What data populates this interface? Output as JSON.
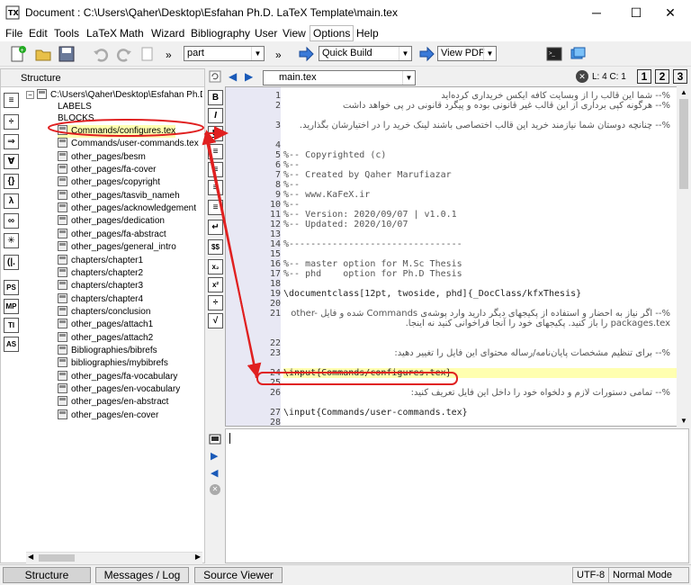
{
  "window": {
    "title": "Document : C:\\Users\\Qaher\\Desktop\\Esfahan Ph.D. LaTeX Template\\main.tex",
    "minimize": "─",
    "maximize": "☐",
    "close": "✕"
  },
  "menu": [
    "File",
    "Edit",
    "Tools",
    "LaTeX",
    "Math",
    "Wizard",
    "Bibliography",
    "User",
    "View",
    "Options",
    "Help"
  ],
  "toolbar": {
    "section_combo": "part",
    "build_combo": "Quick Build",
    "view_combo": "View PDF",
    "more": "»"
  },
  "structure": {
    "header": "Structure",
    "root": "C:\\Users\\Qaher\\Desktop\\Esfahan Ph.D.",
    "labels": "LABELS",
    "blocks": "BLOCKS",
    "files": [
      "Commands/configures.tex",
      "Commands/user-commands.tex",
      "other_pages/besm",
      "other_pages/fa-cover",
      "other_pages/copyright",
      "other_pages/tasvib_nameh",
      "other_pages/acknowledgement",
      "other_pages/dedication",
      "other_pages/fa-abstract",
      "other_pages/general_intro",
      "chapters/chapter1",
      "chapters/chapter2",
      "chapters/chapter3",
      "chapters/chapter4",
      "chapters/conclusion",
      "other_pages/attach1",
      "other_pages/attach2",
      "Bibliographies/bibrefs",
      "bibliographies/mybibrefs",
      "other_pages/fa-vocabulary",
      "other_pages/en-vocabulary",
      "other_pages/en-abstract",
      "other_pages/en-cover"
    ],
    "side_icons": [
      "≡",
      "÷",
      "⇒",
      "∀",
      "{}",
      "λ",
      "∞",
      "✳",
      "(|.",
      "PS",
      "MP",
      "TI",
      "AS"
    ]
  },
  "editor": {
    "file_combo": "main.tex",
    "cursor_pos": "L: 4 C: 1",
    "view_buttons": [
      "1",
      "2",
      "3"
    ],
    "side_icons": [
      "B",
      "I",
      "U",
      "≡",
      "≡",
      "≡",
      "≡",
      "↵",
      "$$",
      "x₂",
      "x²",
      "÷",
      "√"
    ],
    "lines": [
      {
        "n": "1",
        "t": "%-- شما این قالب را از وبسایت کافه ایکس خریداری کرده‌اید",
        "rtl": true
      },
      {
        "n": "2",
        "t": "%-- هرگونه کپی برداری از این قالب غیر قانونی بوده و پیگرد قانونی در پی خواهد داشت",
        "rtl": true
      },
      {
        "n": "3",
        "t": "%-- چنانچه دوستان شما نیازمند خرید این قالب اختصاصی باشند لینک خرید را در اختیارشان بگذارید.",
        "rtl": true
      },
      {
        "n": "4",
        "t": ""
      },
      {
        "n": "5",
        "t": "%-- Copyrighted (c)"
      },
      {
        "n": "6",
        "t": "%--"
      },
      {
        "n": "7",
        "t": "%-- Created by Qaher Marufiazar"
      },
      {
        "n": "8",
        "t": "%--"
      },
      {
        "n": "9",
        "t": "%-- www.KaFeX.ir"
      },
      {
        "n": "10",
        "t": "%--"
      },
      {
        "n": "11",
        "t": "%-- Version: 2020/09/07 | v1.0.1"
      },
      {
        "n": "12",
        "t": "%-- Updated: 2020/10/07"
      },
      {
        "n": "13",
        "t": ""
      },
      {
        "n": "14",
        "t": "%--------------------------------"
      },
      {
        "n": "15",
        "t": ""
      },
      {
        "n": "16",
        "t": "%-- master option for M.Sc Thesis"
      },
      {
        "n": "17",
        "t": "%-- phd    option for Ph.D Thesis"
      },
      {
        "n": "18",
        "t": ""
      },
      {
        "n": "19",
        "t": "\\documentclass[12pt, twoside, phd]{_DocClass/kfxThesis}"
      },
      {
        "n": "20",
        "t": ""
      },
      {
        "n": "21",
        "t": "%-- اگر نیاز به احضار و استفاده از پکیجهای دیگر دارید وارد پوشه‌ی Commands شده و فایل other-packages.tex را باز کنید. پکیجهای خود را آنجا فراخوانی کنید نه اینجا.",
        "rtl": true
      },
      {
        "n": "22",
        "t": ""
      },
      {
        "n": "23",
        "t": "%-- برای تنظیم مشخصات پایان‌نامه/رساله محتوای این فایل را تغییر دهید:",
        "rtl": true
      },
      {
        "n": "24",
        "t": "\\input{Commands/configures.tex}"
      },
      {
        "n": "25",
        "t": ""
      },
      {
        "n": "26",
        "t": "%-- تمامی دستورات لازم و دلخواه خود را داخل این فایل تعریف کنید:",
        "rtl": true
      },
      {
        "n": "27",
        "t": "\\input{Commands/user-commands.tex}"
      },
      {
        "n": "28",
        "t": ""
      }
    ]
  },
  "status": {
    "tabs": [
      "Structure",
      "Messages / Log",
      "Source Viewer"
    ],
    "encoding": "UTF-8",
    "mode": "Normal Mode"
  },
  "colors": {
    "highlight_outline": "#e02020",
    "highlight_fill": "#ffffb0",
    "gutter": "#e8e8f4"
  }
}
